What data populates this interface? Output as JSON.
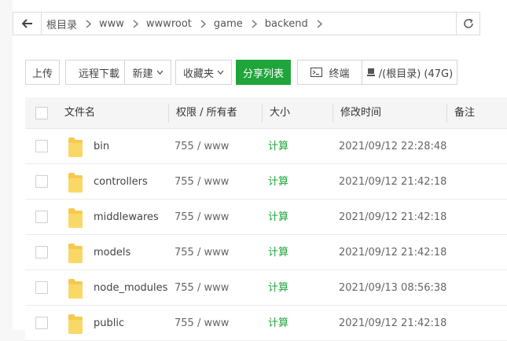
{
  "breadcrumb": {
    "segments": [
      "根目录",
      "www",
      "wwwroot",
      "game",
      "backend"
    ]
  },
  "toolbar": {
    "upload": "上传",
    "remote_download": "远程下載",
    "new": "新建",
    "favorites": "收藏夹",
    "share_list": "分享列表",
    "terminal": "终端",
    "disk": "/(根目录) (47G)"
  },
  "table": {
    "headers": {
      "name": "文件名",
      "perm": "权限 / 所有者",
      "size": "大小",
      "mtime": "修改时间",
      "note": "备注"
    },
    "rows": [
      {
        "name": "bin",
        "perm": "755 / www",
        "size": "计算",
        "mtime": "2021/09/12 22:28:48"
      },
      {
        "name": "controllers",
        "perm": "755 / www",
        "size": "计算",
        "mtime": "2021/09/12 21:42:18"
      },
      {
        "name": "middlewares",
        "perm": "755 / www",
        "size": "计算",
        "mtime": "2021/09/12 21:42:18"
      },
      {
        "name": "models",
        "perm": "755 / www",
        "size": "计算",
        "mtime": "2021/09/12 21:42:18"
      },
      {
        "name": "node_modules",
        "perm": "755 / www",
        "size": "计算",
        "mtime": "2021/09/13 08:56:38"
      },
      {
        "name": "public",
        "perm": "755 / www",
        "size": "计算",
        "mtime": "2021/09/12 21:42:18"
      }
    ]
  },
  "colors": {
    "accent": "#20a53a",
    "folder": "#f6c94e"
  },
  "icons": {
    "back": "arrow-left-icon",
    "refresh": "refresh-icon",
    "crumb_separator": "chevron-right-icon",
    "terminal": "terminal-icon",
    "disk": "disk-icon",
    "folder": "folder-icon"
  }
}
